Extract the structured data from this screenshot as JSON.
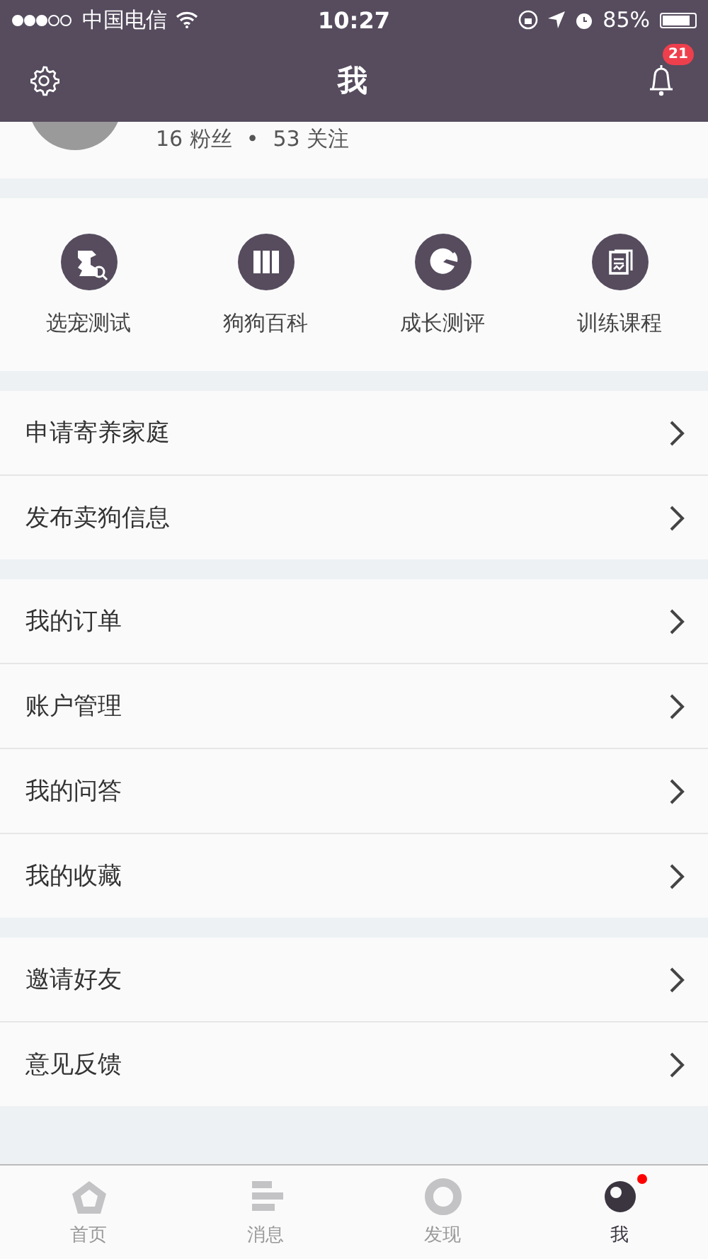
{
  "status_bar": {
    "carrier": "中国电信",
    "time": "10:27",
    "battery": "85%"
  },
  "nav_bar": {
    "title": "我",
    "notification_count": "21"
  },
  "profile": {
    "followers": "16 粉丝",
    "separator": "•",
    "following": "53 关注"
  },
  "shortcuts": [
    {
      "label": "选宠测试",
      "kind": "pet"
    },
    {
      "label": "狗狗百科",
      "kind": "books"
    },
    {
      "label": "成长测评",
      "kind": "pie"
    },
    {
      "label": "训练课程",
      "kind": "document"
    }
  ],
  "menu_groups": [
    {
      "items": [
        "申请寄养家庭",
        "发布卖狗信息"
      ]
    },
    {
      "items": [
        "我的订单",
        "账户管理",
        "我的问答",
        "我的收藏"
      ]
    },
    {
      "items": [
        "邀请好友",
        "意见反馈"
      ]
    }
  ],
  "tab_bar": [
    {
      "label": "首页",
      "kind": "home",
      "selected": false,
      "dot": false
    },
    {
      "label": "消息",
      "kind": "messages",
      "selected": false,
      "dot": false
    },
    {
      "label": "发现",
      "kind": "discover",
      "selected": false,
      "dot": false
    },
    {
      "label": "我",
      "kind": "me",
      "selected": true,
      "dot": true
    }
  ]
}
